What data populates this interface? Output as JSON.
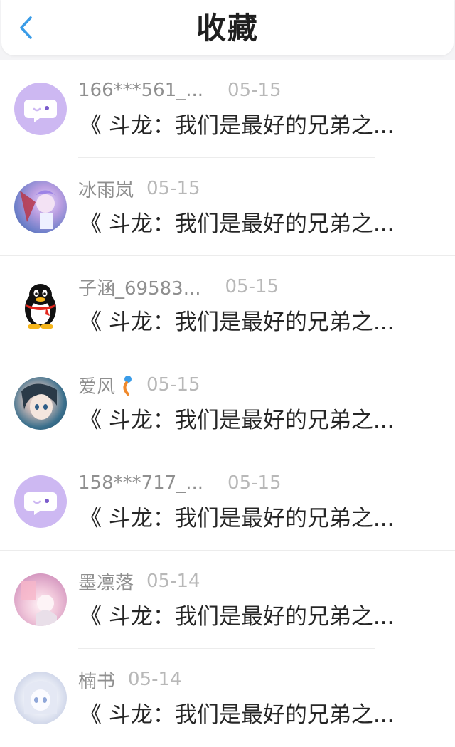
{
  "header": {
    "title": "收藏"
  },
  "items": [
    {
      "nickname": "166***561_...",
      "date": "05-15",
      "content": "《 斗龙：我们是最好的兄弟之...",
      "avatar": "chat-bubble-avatar"
    },
    {
      "nickname": "冰雨岚",
      "date": "05-15",
      "content": "《 斗龙：我们是最好的兄弟之...",
      "avatar": "anime-avatar"
    },
    {
      "nickname": "子涵_69583...",
      "date": "05-15",
      "content": "《 斗龙：我们是最好的兄弟之...",
      "avatar": "penguin-avatar"
    },
    {
      "nickname": "爱风",
      "date": "05-15",
      "content": "《 斗龙：我们是最好的兄弟之...",
      "avatar": "anime-avatar"
    },
    {
      "nickname": "158***717_...",
      "date": "05-15",
      "content": "《 斗龙：我们是最好的兄弟之...",
      "avatar": "chat-bubble-avatar"
    },
    {
      "nickname": "墨凛落",
      "date": "05-14",
      "content": "《 斗龙：我们是最好的兄弟之...",
      "avatar": "anime-avatar"
    },
    {
      "nickname": "楠书",
      "date": "05-14",
      "content": "《 斗龙：我们是最好的兄弟之...",
      "avatar": "anime-avatar"
    }
  ],
  "colors": {
    "accent": "#3a9ce8",
    "chat_avatar": "#cdb8f2"
  }
}
